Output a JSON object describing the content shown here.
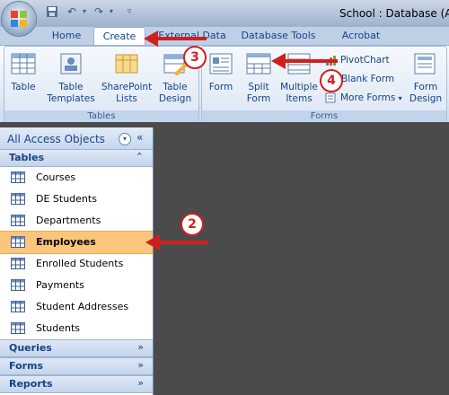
{
  "window": {
    "title": "School : Database (Acce"
  },
  "tabs": [
    {
      "label": "Home"
    },
    {
      "label": "Create"
    },
    {
      "label": "External Data"
    },
    {
      "label": "Database Tools"
    },
    {
      "label": "Acrobat"
    }
  ],
  "ribbon": {
    "tables_group": {
      "label": "Tables",
      "buttons": [
        {
          "label": "Table",
          "icon": "table-icon"
        },
        {
          "label": "Table Templates",
          "icon": "table-templates-icon"
        },
        {
          "label": "SharePoint Lists",
          "icon": "sharepoint-lists-icon"
        },
        {
          "label": "Table Design",
          "icon": "table-design-icon"
        }
      ]
    },
    "forms_group": {
      "label": "Forms",
      "buttons": [
        {
          "label": "Form",
          "icon": "form-icon"
        },
        {
          "label": "Split Form",
          "icon": "split-form-icon"
        },
        {
          "label": "Multiple Items",
          "icon": "multiple-items-icon"
        },
        {
          "label": "Form Design",
          "icon": "form-design-icon"
        }
      ],
      "small_buttons": [
        {
          "label": "PivotChart",
          "icon": "pivotchart-icon"
        },
        {
          "label": "Blank Form",
          "icon": "blank-form-icon"
        },
        {
          "label": "More Forms",
          "icon": "more-forms-icon"
        }
      ]
    }
  },
  "nav": {
    "title": "All Access Objects",
    "tables_header": "Tables",
    "tables": [
      {
        "label": "Courses"
      },
      {
        "label": "DE Students"
      },
      {
        "label": "Departments"
      },
      {
        "label": "Employees"
      },
      {
        "label": "Enrolled Students"
      },
      {
        "label": "Payments"
      },
      {
        "label": "Student Addresses"
      },
      {
        "label": "Students"
      }
    ],
    "selected_table": "Employees",
    "collapsed_sections": [
      {
        "label": "Queries"
      },
      {
        "label": "Forms"
      },
      {
        "label": "Reports"
      }
    ]
  },
  "callouts": [
    {
      "number": "2"
    },
    {
      "number": "3"
    },
    {
      "number": "4"
    }
  ],
  "colors": {
    "accent": "#15428b",
    "selected_row": "#fbc67c",
    "callout_red": "#d0201d",
    "workspace": "#4b4b4b"
  }
}
